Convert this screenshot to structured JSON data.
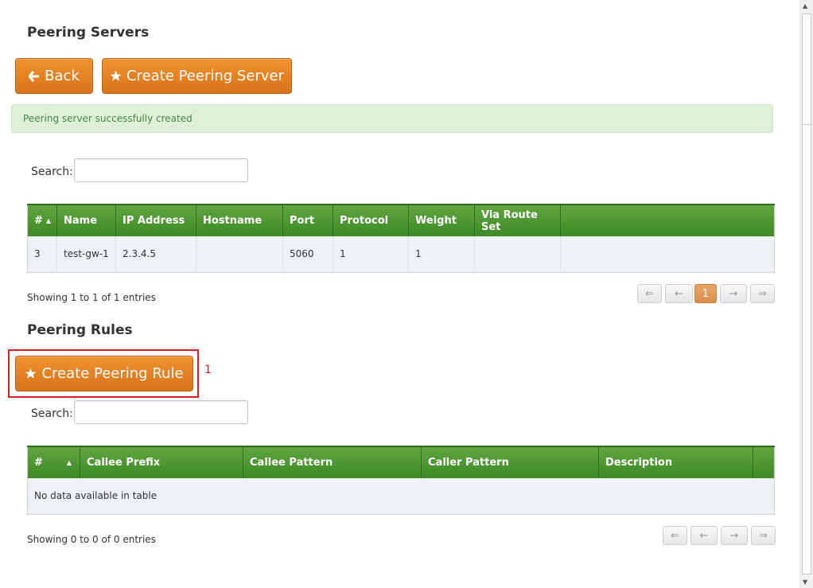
{
  "peering_servers": {
    "title": "Peering Servers",
    "back_label": "Back",
    "create_label": "Create Peering Server",
    "alert": "Peering server successfully created",
    "search_label": "Search:",
    "search_value": "",
    "columns": [
      "#",
      "Name",
      "IP Address",
      "Hostname",
      "Port",
      "Protocol",
      "Weight",
      "Via Route Set",
      ""
    ],
    "rows": [
      [
        "3",
        "test-gw-1",
        "2.3.4.5",
        "",
        "5060",
        "1",
        "1",
        "",
        ""
      ]
    ],
    "info": "Showing 1 to 1 of 1 entries",
    "pager": [
      "⇐",
      "←",
      "1",
      "→",
      "⇒"
    ],
    "current_page": "1"
  },
  "peering_rules": {
    "title": "Peering Rules",
    "create_label": "Create Peering Rule",
    "search_label": "Search:",
    "search_value": "",
    "columns": [
      "#",
      "Callee Prefix",
      "Callee Pattern",
      "Caller Pattern",
      "Description",
      ""
    ],
    "empty_message": "No data available in table",
    "info": "Showing 0 to 0 of 0 entries",
    "pager": [
      "⇐",
      "←",
      "→",
      "⇒"
    ]
  },
  "annotation": {
    "number": "1",
    "color": "#d61f1f"
  },
  "colors": {
    "accent_orange": "#e07f24",
    "header_green": "#4e9a32",
    "alert_bg": "#dff0d8",
    "alert_text": "#468847"
  },
  "icons": {
    "back": "arrow-left-icon",
    "create": "star-icon"
  }
}
